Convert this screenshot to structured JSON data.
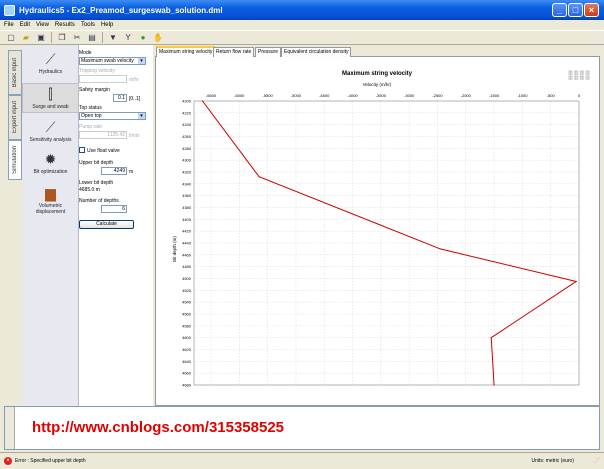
{
  "window": {
    "title": "Hydraulics5 - Ex2_Preamod_surgeswab_solution.dml"
  },
  "menu": [
    "File",
    "Edit",
    "View",
    "Results",
    "Tools",
    "Help"
  ],
  "vertical_tabs": [
    "Basic input",
    "Expert input",
    "Simulation"
  ],
  "modules": [
    {
      "label": "Hydraulics",
      "icon": "hydraulics-icon"
    },
    {
      "label": "Surge and swab",
      "icon": "surge-swab-icon"
    },
    {
      "label": "Sensitivity analysis",
      "icon": "sensitivity-icon"
    },
    {
      "label": "Bit optimization",
      "icon": "bit-icon"
    },
    {
      "label": "Volumetric displacement",
      "icon": "volumetric-icon"
    }
  ],
  "form": {
    "mode_label": "Mode",
    "mode_value": "Maximum swab velocity",
    "tripping_velocity_label": "Tripping velocity",
    "tripping_velocity_unit": "m/hr",
    "safety_margin_label": "Safety margin",
    "safety_margin_value": "0.1",
    "safety_margin_unit": "[0..1]",
    "top_status_label": "Top status",
    "top_status_value": "Open top",
    "pump_rate_label": "Pump rate",
    "pump_rate_value": "1125.42",
    "pump_rate_unit": "l/min",
    "float_valve_label": "Use float valve",
    "upper_depth_label": "Upper bit depth",
    "upper_depth_value": "4249",
    "upper_depth_unit": "m",
    "lower_depth_label": "Lower bit depth",
    "lower_depth_value": "4685.0 m",
    "num_depths_label": "Number of depths",
    "num_depths_value": "6",
    "calculate_label": "Calculate"
  },
  "tabs": [
    "Maximum string velocity",
    "Return flow rate",
    "Pressure",
    "Equivalent circulation density"
  ],
  "chart_data": {
    "type": "line",
    "title": "Maximum string velocity",
    "xlabel": "Velocity (m/hr)",
    "ylabel": "Bit depth (m)",
    "xlim": [
      -6800,
      0
    ],
    "ylim": [
      4200,
      4680
    ],
    "x_ticks": [
      -6500,
      -6000,
      -5500,
      -5000,
      -4500,
      -4000,
      -3500,
      -3000,
      -2500,
      -2000,
      -1500,
      -1000,
      -500,
      0
    ],
    "y_ticks": [
      4200,
      4220,
      4240,
      4260,
      4280,
      4300,
      4320,
      4340,
      4360,
      4380,
      4400,
      4420,
      4440,
      4460,
      4480,
      4500,
      4520,
      4540,
      4560,
      4580,
      4600,
      4620,
      4640,
      4660,
      4680
    ],
    "x_inverted": true,
    "y_inverted": true,
    "grid": true,
    "color": "#cc0000",
    "series": [
      {
        "points": [
          [
            -6650,
            4200
          ],
          [
            -5650,
            4328
          ],
          [
            -2450,
            4450
          ],
          [
            -50,
            4505
          ],
          [
            -1550,
            4600
          ],
          [
            -1500,
            4680
          ]
        ]
      }
    ]
  },
  "watermark": "http://www.cnblogs.com/315358525",
  "status": {
    "message": "Error : Specified upper bit depth",
    "units": "Units: metric (euro)"
  }
}
